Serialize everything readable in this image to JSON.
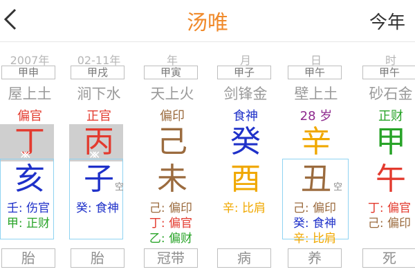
{
  "header": {
    "back_icon": "chevron-left-icon",
    "title": "汤唯",
    "right_label": "今年"
  },
  "colors": {
    "brown": "#9b6b3e",
    "red": "#e33a2e",
    "blue": "#1f31c9",
    "green": "#27a327",
    "gold": "#f0a800",
    "purple": "#8e2a8e",
    "title": "#f08a2b",
    "highlight": "#8ed3f2"
  },
  "columns": [
    {
      "caption": "2007年",
      "ganzhi": "甲申",
      "nayin": "屋上土",
      "role": "偏官",
      "stem": "丁",
      "branch": "亥",
      "stem_marked": true,
      "branch_marked": true,
      "selected": true,
      "kong": "",
      "hidden": [
        {
          "text": "壬: 伤官",
          "color": "blue"
        },
        {
          "text": "甲: 正财",
          "color": "green"
        }
      ],
      "life": "胎"
    },
    {
      "caption": "02-11年",
      "ganzhi": "甲戌",
      "nayin": "涧下水",
      "role": "正官",
      "stem": "丙",
      "branch": "子",
      "stem_marked": true,
      "branch_marked": true,
      "selected": true,
      "kong": "空",
      "hidden": [
        {
          "text": "癸: 食神",
          "color": "blue"
        }
      ],
      "life": "胎"
    },
    {
      "caption": "年",
      "ganzhi": "甲寅",
      "nayin": "天上火",
      "role": "偏印",
      "stem": "己",
      "branch": "未",
      "stem_marked": false,
      "branch_marked": false,
      "selected": false,
      "kong": "",
      "hidden": [
        {
          "text": "己: 偏印",
          "color": "brown"
        },
        {
          "text": "丁: 偏官",
          "color": "red"
        },
        {
          "text": "乙: 偏财",
          "color": "green"
        }
      ],
      "life": "冠带"
    },
    {
      "caption": "月",
      "ganzhi": "甲子",
      "nayin": "剑锋金",
      "role": "食神",
      "stem": "癸",
      "branch": "酉",
      "stem_marked": false,
      "branch_marked": false,
      "selected": false,
      "kong": "",
      "hidden": [
        {
          "text": "辛: 比肩",
          "color": "gold"
        }
      ],
      "life": "病"
    },
    {
      "caption": "日",
      "ganzhi": "甲午",
      "nayin": "壁上土",
      "role": "28 岁",
      "stem": "辛",
      "branch": "丑",
      "stem_marked": false,
      "branch_marked": false,
      "selected": true,
      "kong": "空",
      "hidden": [
        {
          "text": "己: 偏印",
          "color": "brown"
        },
        {
          "text": "癸: 食神",
          "color": "blue"
        },
        {
          "text": "辛: 比肩",
          "color": "gold"
        }
      ],
      "life": "养"
    },
    {
      "caption": "时",
      "ganzhi": "甲午",
      "nayin": "砂石金",
      "role": "正财",
      "stem": "甲",
      "branch": "午",
      "stem_marked": false,
      "branch_marked": false,
      "selected": false,
      "kong": "",
      "hidden": [
        {
          "text": "丁: 偏官",
          "color": "red"
        },
        {
          "text": "己: 偏印",
          "color": "brown"
        }
      ],
      "life": "死"
    }
  ]
}
